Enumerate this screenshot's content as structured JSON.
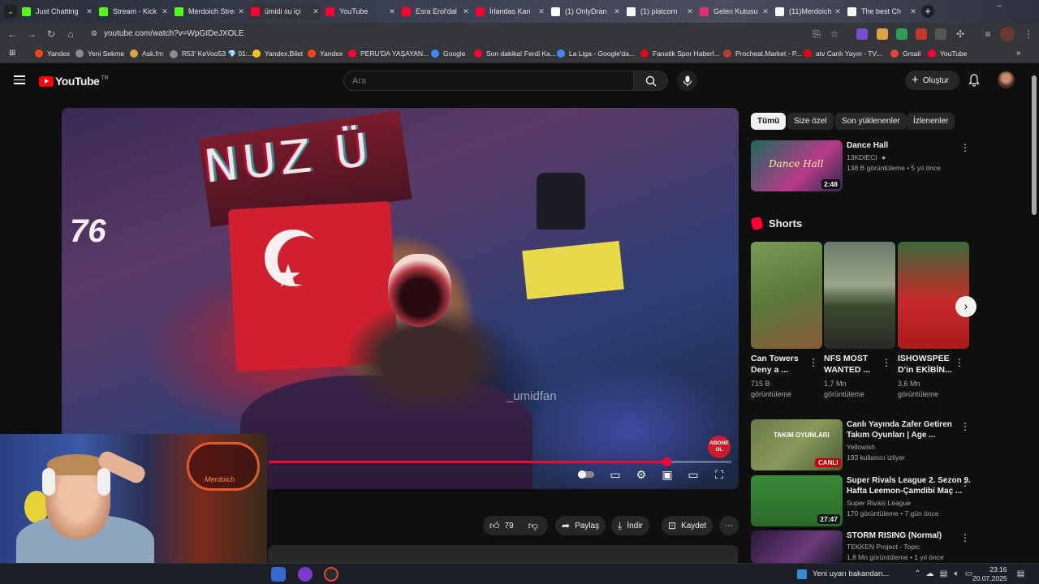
{
  "browser": {
    "tabs": [
      {
        "title": "Just Chatting",
        "favicon_color": "#53fc18"
      },
      {
        "title": "Stream - Kick",
        "favicon_color": "#53fc18"
      },
      {
        "title": "Merdoich Stream",
        "favicon_color": "#53fc18"
      },
      {
        "title": "ümidi su içi",
        "favicon_color": "#ff0033"
      },
      {
        "title": "YouTube",
        "favicon_color": "#ff0033"
      },
      {
        "title": "Esra Erol'dal",
        "favicon_color": "#ff0033"
      },
      {
        "title": "İrlandas Kan",
        "favicon_color": "#ff0033"
      },
      {
        "title": "(1) OnlyDran",
        "favicon_color": "#ffffff"
      },
      {
        "title": "(1) platcorn",
        "favicon_color": "#ffffff"
      },
      {
        "title": "Gelen Kutusu",
        "favicon_color": "#e1306c"
      },
      {
        "title": "(11)Merdoich",
        "favicon_color": "#ffffff"
      },
      {
        "title": "The best Ch",
        "favicon_color": "#ffffff"
      }
    ],
    "url": "youtube.com/watch?v=WpGIDeJXOLE",
    "bookmarks": [
      {
        "label": "Yandex",
        "color": "#fc3f1d"
      },
      {
        "label": "Yeni Sekme",
        "color": "#8a8a8a"
      },
      {
        "label": "Ask.fm",
        "color": "#d9a441"
      },
      {
        "label": "R53' KeVoo53 💎 01:...",
        "color": "#8a8a8a"
      },
      {
        "label": "Yandex.Bilet",
        "color": "#f5c518"
      },
      {
        "label": "Yandex",
        "color": "#fc3f1d"
      },
      {
        "label": "PERU'DA YAŞAYAN...",
        "color": "#ff0033"
      },
      {
        "label": "Google",
        "color": "#4285f4"
      },
      {
        "label": "Son dakika! Ferdi Ka...",
        "color": "#ff0033"
      },
      {
        "label": "La Liga - Google'da...",
        "color": "#4285f4"
      },
      {
        "label": "Fanatik Spor Haberl...",
        "color": "#e30613"
      },
      {
        "label": "Procheat.Market - P...",
        "color": "#c0392b"
      },
      {
        "label": "atv Canlı Yayın - TV...",
        "color": "#e30613"
      },
      {
        "label": "Gmail",
        "color": "#ea4335"
      },
      {
        "label": "YouTube",
        "color": "#ff0033"
      }
    ]
  },
  "youtube": {
    "logo_text": "YouTube",
    "logo_country": "TR",
    "search_placeholder": "Ara",
    "create_label": "Oluştur",
    "accent": "#ff0033"
  },
  "player": {
    "banner_text": "NUZ Ü",
    "jersey_number": "76",
    "watermark": "_umidfan",
    "subscribe_overlay": "ABONE OL",
    "progress_fraction": 0.86,
    "webcam_sign": "Merdoich"
  },
  "actions": {
    "likes": "79",
    "share": "Paylaş",
    "download": "İndir",
    "save": "Kaydet"
  },
  "sidebar": {
    "chips": [
      "Tümü",
      "Size özel",
      "Son yüklenenler",
      "İzlenenler"
    ],
    "top_video": {
      "title": "Dance Hall",
      "thumb_text": "Dance Hall",
      "channel": "13KDIECI",
      "meta": "138 B görüntüleme • 5 yıl önce",
      "duration": "2:48"
    },
    "shorts_heading": "Shorts",
    "shorts": [
      {
        "title_l1": "Can Towers",
        "title_l2": "Deny a ...",
        "views_l1": "715 B",
        "views_l2": "görüntüleme"
      },
      {
        "title_l1": "NFS MOST",
        "title_l2": "WANTED ...",
        "views_l1": "1,7 Mn",
        "views_l2": "görüntüleme"
      },
      {
        "title_l1": "ISHOWSPEE",
        "title_l2": "D'in EKİBİN...",
        "views_l1": "3,6 Mn",
        "views_l2": "görüntüleme"
      }
    ],
    "videos": [
      {
        "title_l1": "Canlı Yayında Zafer Getiren",
        "title_l2": "Takım Oyunları | Age ...",
        "channel": "Yellowish",
        "meta": "193 kullanıcı izliyor",
        "badge": "CANLI",
        "thumb_text": "TAKIM OYUNLARI"
      },
      {
        "title_l1": "Super Rivals League 2. Sezon 9.",
        "title_l2": "Hafta Leemon-Çamdibi Maç ...",
        "channel": "Super Rivals League",
        "meta": "170 görüntüleme • 7 gün önce",
        "duration": "27:47"
      },
      {
        "title_l1": "STORM RISING (Normal)",
        "title_l2": "",
        "channel": "TEKKEN Project - Topic",
        "meta": "1,8 Mn görüntüleme • 1 yıl önce"
      }
    ]
  },
  "taskbar": {
    "weather_text": "Yeni uyarı bakandan...",
    "time": "23:16",
    "date": "20.07.2025"
  }
}
